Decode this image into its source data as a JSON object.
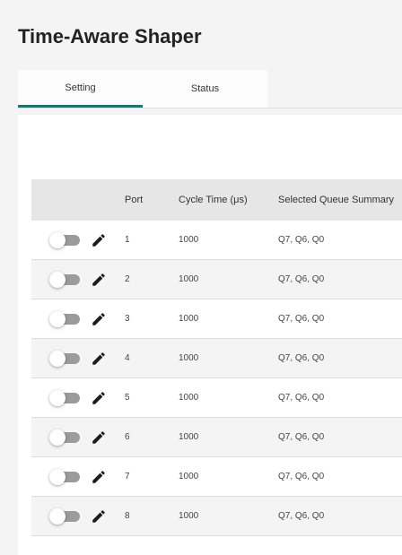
{
  "page": {
    "title": "Time-Aware Shaper"
  },
  "tabs": [
    {
      "label": "Setting",
      "active": true
    },
    {
      "label": "Status",
      "active": false
    }
  ],
  "table": {
    "columns": {
      "port": "Port",
      "cycle_time": "Cycle Time (μs)",
      "queue_summary": "Selected Queue Summary"
    },
    "rows": [
      {
        "enabled": false,
        "port": "1",
        "cycle_time": "1000",
        "queue_summary": "Q7, Q6, Q0"
      },
      {
        "enabled": false,
        "port": "2",
        "cycle_time": "1000",
        "queue_summary": "Q7, Q6, Q0"
      },
      {
        "enabled": false,
        "port": "3",
        "cycle_time": "1000",
        "queue_summary": "Q7, Q6, Q0"
      },
      {
        "enabled": false,
        "port": "4",
        "cycle_time": "1000",
        "queue_summary": "Q7, Q6, Q0"
      },
      {
        "enabled": false,
        "port": "5",
        "cycle_time": "1000",
        "queue_summary": "Q7, Q6, Q0"
      },
      {
        "enabled": false,
        "port": "6",
        "cycle_time": "1000",
        "queue_summary": "Q7, Q6, Q0"
      },
      {
        "enabled": false,
        "port": "7",
        "cycle_time": "1000",
        "queue_summary": "Q7, Q6, Q0"
      },
      {
        "enabled": false,
        "port": "8",
        "cycle_time": "1000",
        "queue_summary": "Q7, Q6, Q0"
      }
    ]
  },
  "colors": {
    "accent": "#0a7d73",
    "toggle_off_track": "#9b9b9b",
    "header_bg": "#e6e6e6",
    "row_alt_bg": "#f4f4f4"
  },
  "icons": {
    "edit": "pencil-icon"
  }
}
